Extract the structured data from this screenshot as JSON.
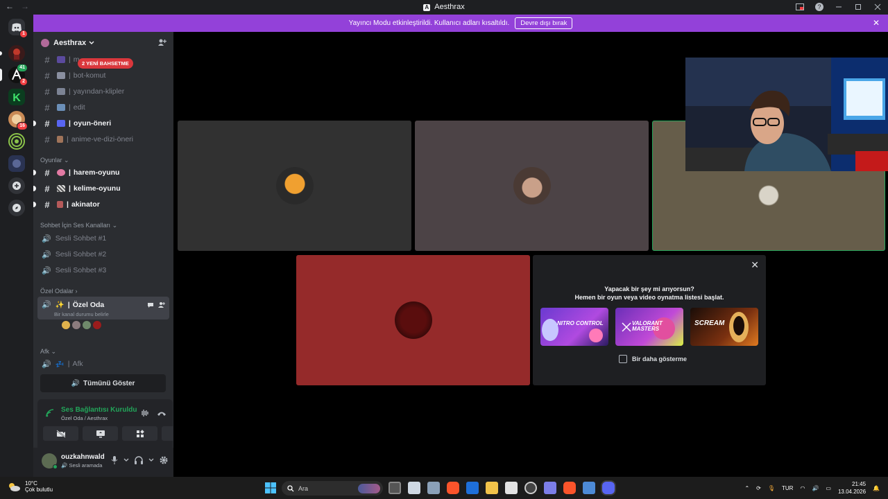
{
  "window": {
    "title": "Aesthrax",
    "nav_back": "←",
    "nav_forward": "→"
  },
  "banner": {
    "text": "Yayıncı Modu etkinleştirildi. Kullanıcı adları kısaltıldı.",
    "button": "Devre dışı bırak"
  },
  "guilds": {
    "badges": [
      "1",
      "41",
      "2",
      "16"
    ]
  },
  "server": {
    "name": "Aesthrax"
  },
  "mention_pill": "2 YENİ BAHSETME",
  "channels": [
    {
      "name": "m…",
      "unread": false
    },
    {
      "name": "bot-komut",
      "unread": false
    },
    {
      "name": "yayından-klipler",
      "unread": false
    },
    {
      "name": "edit",
      "unread": false
    },
    {
      "name": "oyun-öneri",
      "unread": true
    },
    {
      "name": "anime-ve-dizi-öneri",
      "unread": false
    }
  ],
  "categories": {
    "oyunlar": "Oyunlar",
    "sohbet": "Sohbet İçin Ses Kanalları",
    "ozel": "Özel Odalar",
    "afk": "Afk"
  },
  "game_channels": [
    {
      "name": "harem-oyunu"
    },
    {
      "name": "kelime-oyunu"
    },
    {
      "name": "akinator"
    }
  ],
  "voice_channels": [
    {
      "name": "Sesli Sohbet #1"
    },
    {
      "name": "Sesli Sohbet #2"
    },
    {
      "name": "Sesli Sohbet #3"
    }
  ],
  "active_voice": {
    "name": "Özel Oda",
    "status": "Bir kanal durumu belirle"
  },
  "afk_channel": "Afk",
  "show_all": "Tümünü Göster",
  "connection": {
    "title": "Ses Bağlantısı Kuruldu",
    "subtitle": "Özel Oda / Aesthrax"
  },
  "user": {
    "name": "ouzkahnwald",
    "status": "Sesli aramada"
  },
  "promo": {
    "line1": "Yapacak bir şey mi arıyorsun?",
    "line2": "Hemen bir oyun veya video oynatma listesi başlat.",
    "games": [
      "NITRO CONTROL",
      "VALORANT MASTERS",
      "SCREAM"
    ],
    "checkbox": "Bir daha gösterme"
  },
  "taskbar": {
    "temp": "10°C",
    "weather": "Çok bulutlu",
    "search_placeholder": "Ara",
    "lang": "TUR",
    "time": "21:45",
    "date": "13.04.2026"
  }
}
